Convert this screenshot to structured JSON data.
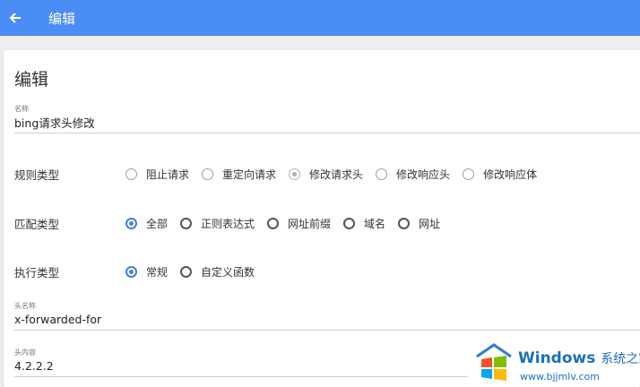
{
  "appbar": {
    "title": "编辑"
  },
  "form": {
    "title": "编辑",
    "name_label": "名称",
    "name_value": "bing请求头修改",
    "rule_type": {
      "label": "规则类型",
      "options": [
        "阻止请求",
        "重定向请求",
        "修改请求头",
        "修改响应头",
        "修改响应体"
      ],
      "selected": "修改请求头"
    },
    "match_type": {
      "label": "匹配类型",
      "options": [
        "全部",
        "正则表达式",
        "网址前缀",
        "域名",
        "网址"
      ],
      "selected": "全部"
    },
    "exec_type": {
      "label": "执行类型",
      "options": [
        "常规",
        "自定义函数"
      ],
      "selected": "常规"
    },
    "header_name_label": "头名称",
    "header_name_value": "x-forwarded-for",
    "header_value_label": "头内容",
    "header_value_value": "4.2.2.2"
  },
  "watermark": {
    "title": "Windows",
    "title_cn": "系统之家",
    "url": "www.bjjmlv.com"
  },
  "colors": {
    "appbar": "#4a8df4",
    "accent": "#3f7fe6"
  },
  "icons": {
    "back": "arrow-left-icon",
    "watermark_logo": "windows-logo-icon"
  }
}
